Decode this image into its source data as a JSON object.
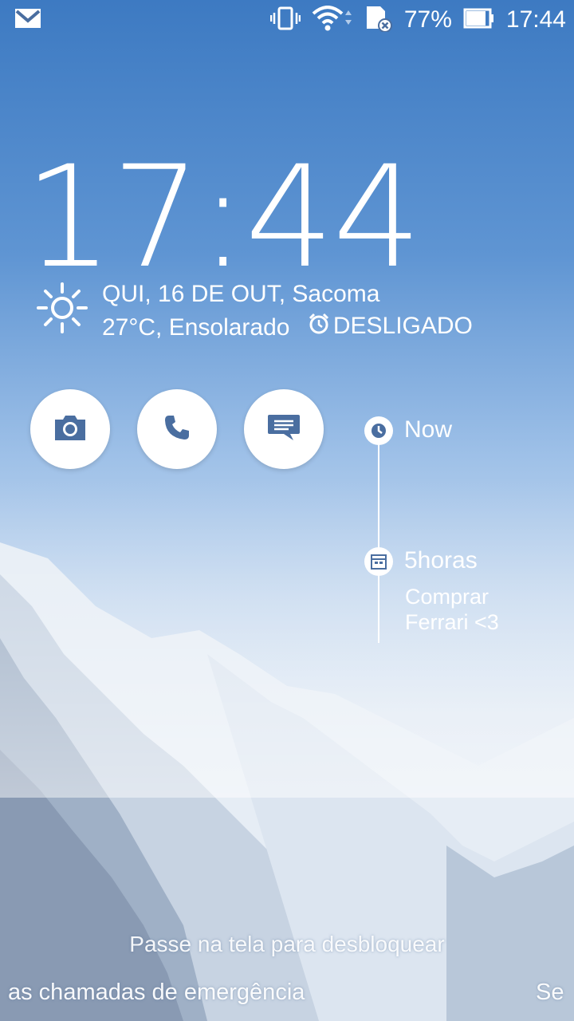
{
  "status_bar": {
    "battery_percent": "77%",
    "time": "17:44",
    "icons": [
      "gmail-icon",
      "vibrate-icon",
      "wifi-icon",
      "sd-card-error-icon",
      "battery-icon"
    ]
  },
  "lockscreen": {
    "clock": "17:44",
    "date_location": "QUI, 16 DE OUT, Sacoma",
    "weather": "27°C, Ensolarado",
    "alarm_status": "DESLIGADO"
  },
  "shortcuts": [
    {
      "name": "camera",
      "icon": "camera-icon"
    },
    {
      "name": "phone",
      "icon": "phone-icon"
    },
    {
      "name": "messages",
      "icon": "message-icon"
    }
  ],
  "timeline": {
    "now_label": "Now",
    "event_time": "5horas",
    "event_title": "Comprar Ferrari <3"
  },
  "footer": {
    "unlock_hint": "Passe na tela para desbloquear",
    "emergency_text": "as chamadas de emergência",
    "right_partial": "Se"
  },
  "colors": {
    "accent_blue": "#4a6ea0",
    "sky_top": "#3d7ac2"
  }
}
